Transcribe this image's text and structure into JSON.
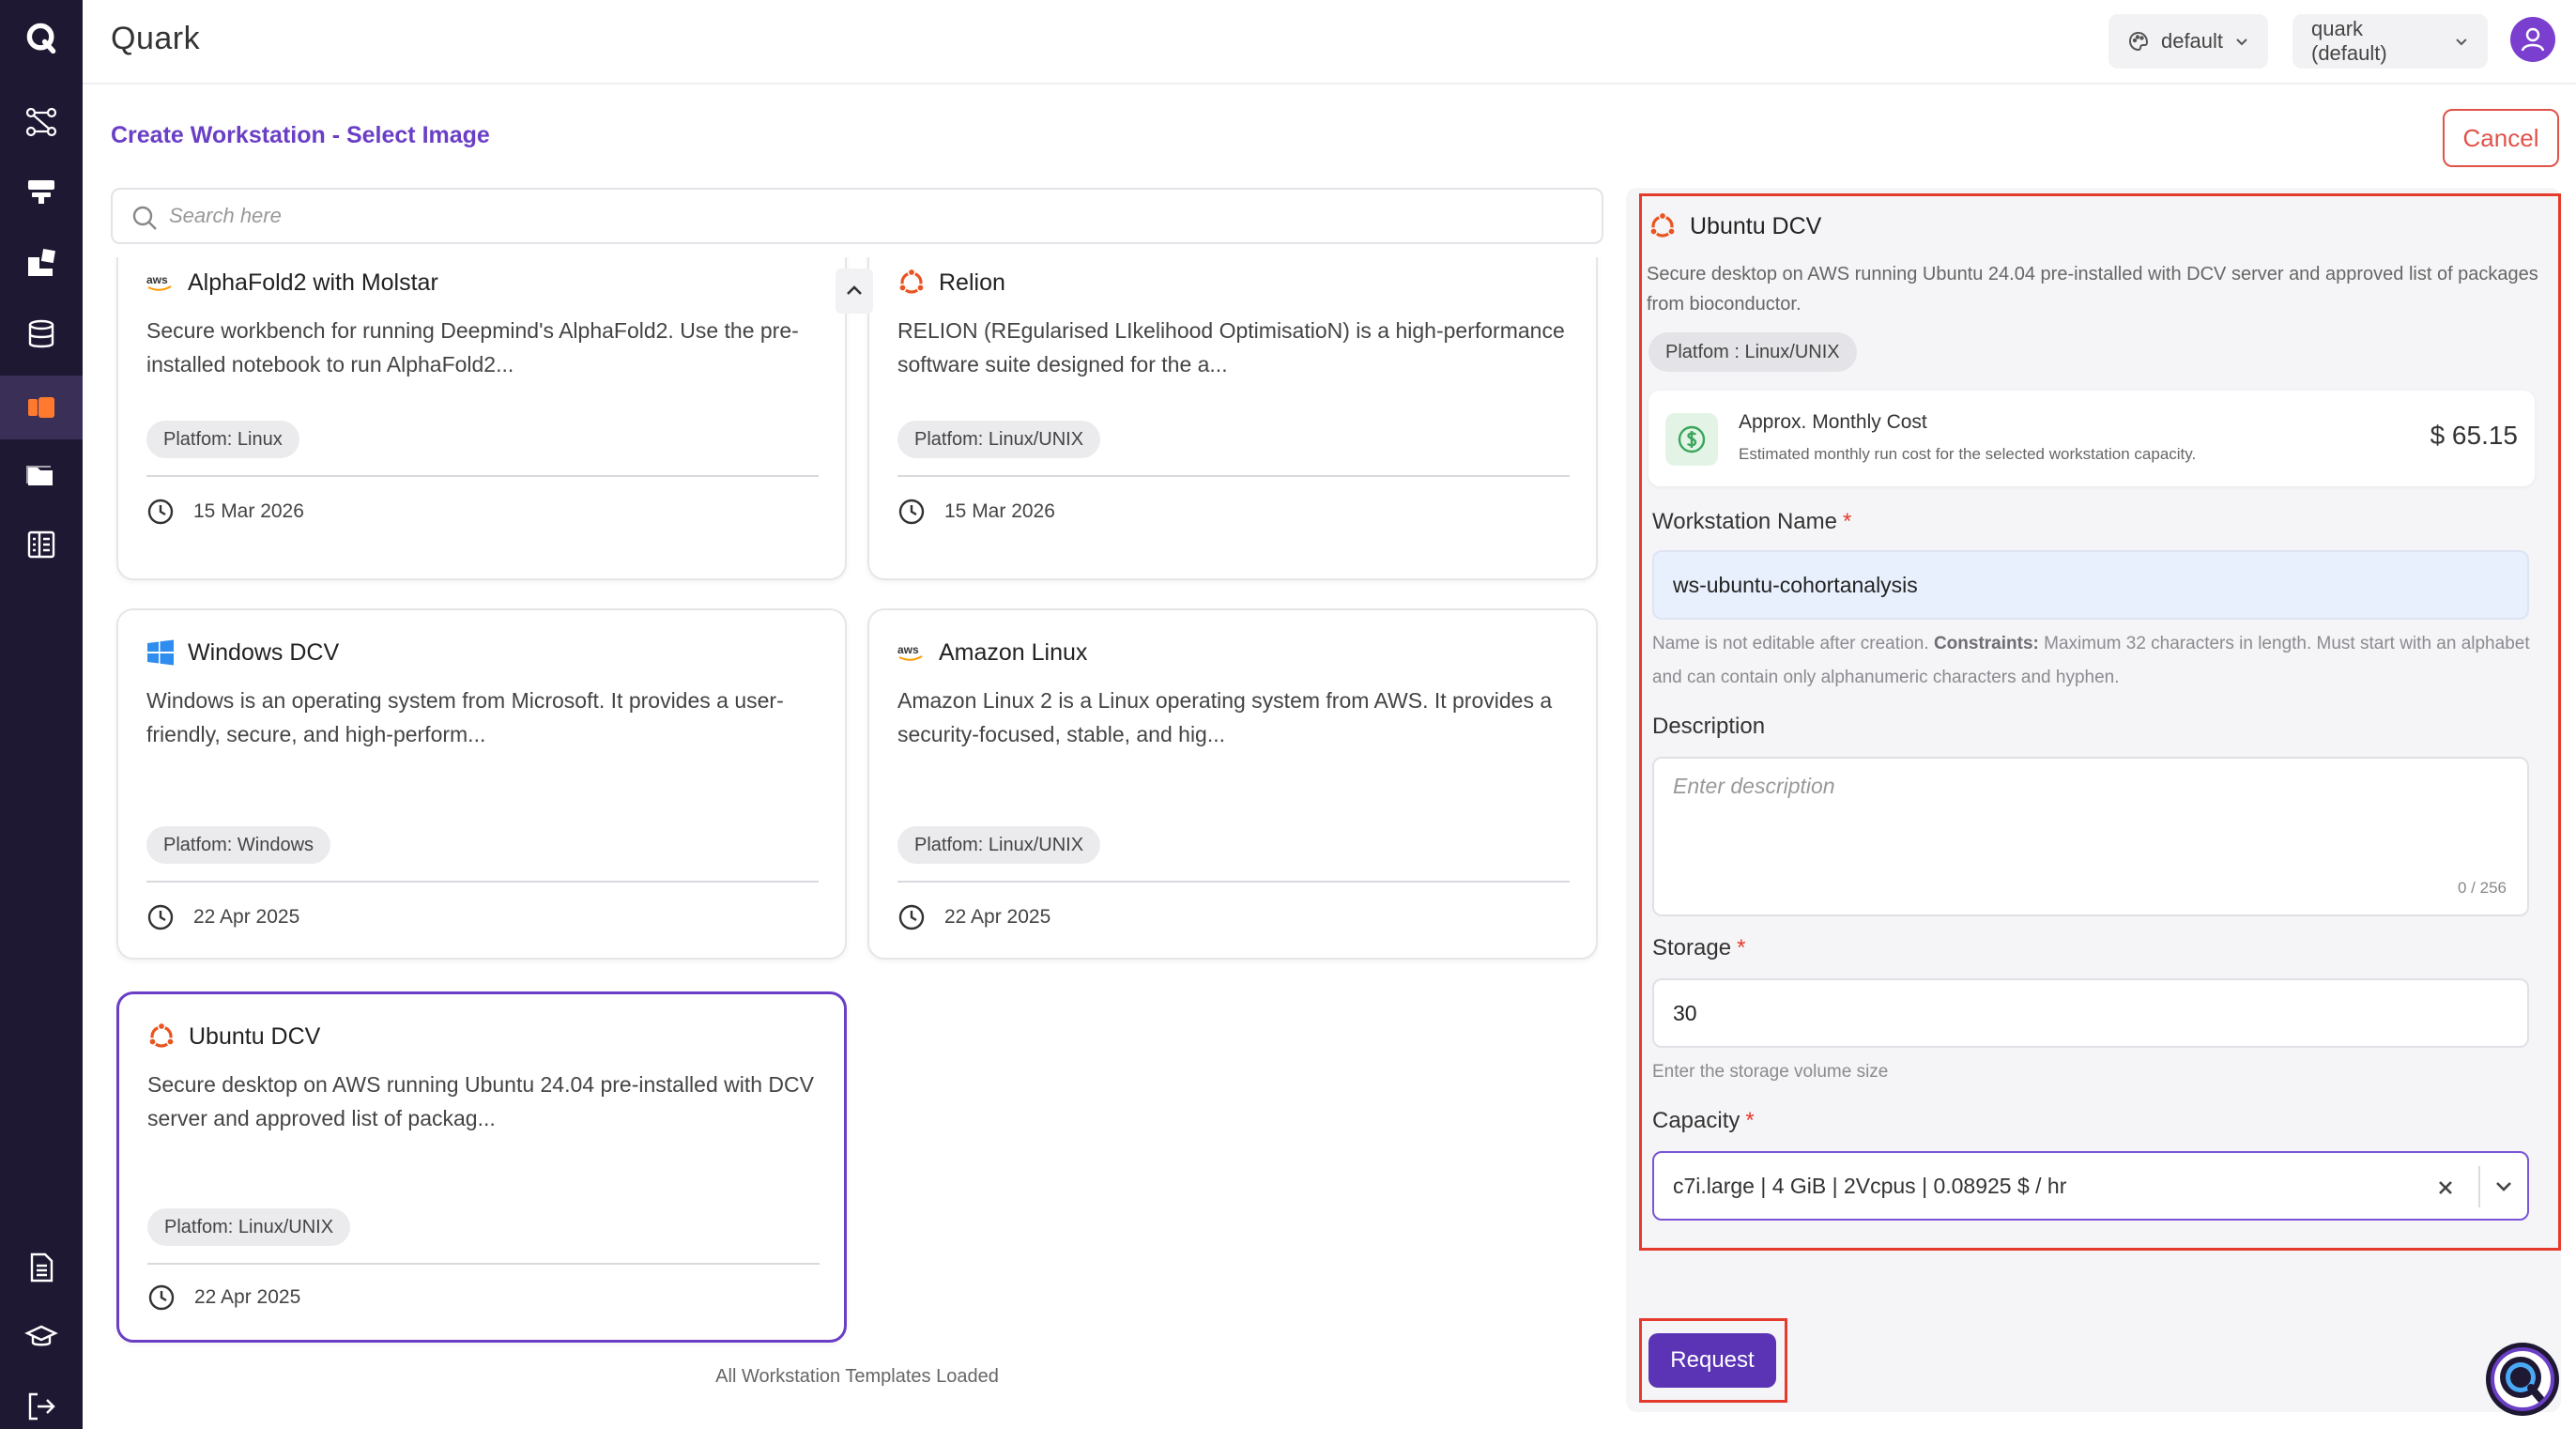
{
  "app": {
    "title": "Quark",
    "logo_letter": "Q"
  },
  "header": {
    "theme_select": "default",
    "project_select": "quark (default)"
  },
  "page": {
    "title": "Create Workstation - Select Image",
    "cancel_label": "Cancel"
  },
  "search": {
    "placeholder": "Search here",
    "value": ""
  },
  "cards": [
    {
      "title": "AlphaFold2 with Molstar",
      "logo": "aws-logo",
      "description": "Secure workbench for running Deepmind's AlphaFold2. Use the pre-installed notebook to run AlphaFold2...",
      "platform": "Platfom: Linux",
      "date": "15 Mar 2026"
    },
    {
      "title": "Relion",
      "logo": "ubuntu-logo",
      "description": "RELION (REgularised LIkelihood OptimisatioN) is a high-performance software suite designed for the a...",
      "platform": "Platfom: Linux/UNIX",
      "date": "15 Mar 2026"
    },
    {
      "title": "Windows DCV",
      "logo": "windows-logo",
      "description": "Windows is an operating system from Microsoft. It provides a user-friendly, secure, and high-perform...",
      "platform": "Platfom: Windows",
      "date": "22 Apr 2025"
    },
    {
      "title": "Amazon Linux",
      "logo": "aws-logo",
      "description": "Amazon Linux 2 is a Linux operating system from AWS. It provides a security-focused, stable, and hig...",
      "platform": "Platfom: Linux/UNIX",
      "date": "22 Apr 2025"
    },
    {
      "title": "Ubuntu DCV",
      "logo": "ubuntu-logo",
      "description": "Secure desktop on AWS running Ubuntu 24.04 pre-installed with DCV server and approved list of packag...",
      "platform": "Platfom: Linux/UNIX",
      "date": "22 Apr 2025",
      "selected": true
    }
  ],
  "list_status": "All Workstation Templates Loaded",
  "panel": {
    "title": "Ubuntu DCV",
    "description": "Secure desktop on AWS running Ubuntu 24.04 pre-installed with DCV server and approved list of packages from bioconductor.",
    "platform": "Platfom : Linux/UNIX",
    "cost": {
      "label": "Approx. Monthly Cost",
      "sublabel": "Estimated monthly run cost for the selected workstation capacity.",
      "value": "$ 65.15"
    },
    "name_field": {
      "label": "Workstation Name",
      "value": "ws-ubuntu-cohortanalysis",
      "helper_prefix": "Name is not editable after creation.",
      "helper_bold": "Constraints:",
      "helper_rest": "Maximum 32 characters in length. Must start with an alphabet and can contain only alphanumeric characters and hyphen."
    },
    "description_field": {
      "label": "Description",
      "placeholder": "Enter description",
      "counter": "0 / 256"
    },
    "storage_field": {
      "label": "Storage",
      "value": "30",
      "helper": "Enter the storage volume size"
    },
    "capacity_field": {
      "label": "Capacity",
      "value": "c7i.large | 4 GiB | 2Vcpus | 0.08925 $ / hr"
    },
    "required_mark": "*",
    "request_label": "Request"
  },
  "colors": {
    "sidebar": "#1e1833",
    "accent": "#6a3fc6",
    "danger": "#e53b2d",
    "ubuntu": "#e95420"
  }
}
